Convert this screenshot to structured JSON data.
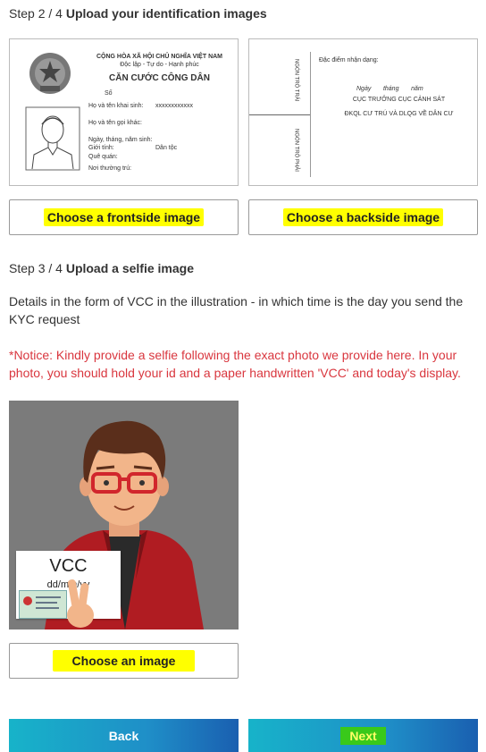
{
  "step2": {
    "prefix": "Step 2 / 4",
    "title": "Upload your identification images"
  },
  "front_card": {
    "line1": "CỘNG HÒA XÃ HỘI CHỦ NGHĨA VIỆT NAM",
    "line2": "Độc lập - Tự do - Hạnh phúc",
    "title": "CĂN CƯỚC CÔNG DÂN",
    "so": "Số",
    "name_label": "Họ và tên khai sinh:",
    "name_value": "xxxxxxxxxxxx",
    "other_name": "Họ và tên gọi khác:",
    "dob": "Ngày, tháng, năm sinh:",
    "gender": "Giới tính:",
    "ethnicity": "Dân tộc",
    "hometown": "Quê quán:",
    "residence": "Nơi thường trú:"
  },
  "back_card": {
    "features": "Đặc điểm nhận dạng:",
    "date_line": "Ngày       tháng       năm",
    "authority1": "CỤC TRƯỞNG CỤC CẢNH SÁT",
    "authority2": "ĐKQL CƯ TRÚ VÀ DLQG VỀ DÂN CƯ",
    "finger1": "NGÓN TRỎ TRÁI",
    "finger2": "NGÓN TRỎ PHẢI"
  },
  "buttons": {
    "front": "Choose a frontside image",
    "back": "Choose a backside image",
    "selfie": "Choose an image",
    "nav_back": "Back",
    "nav_next": "Next"
  },
  "step3": {
    "prefix": "Step 3 / 4",
    "title": "Upload a selfie image"
  },
  "details": "Details in the form of VCC in the illustration - in which time is the day you send the KYC request",
  "notice": "*Notice: Kindly provide a selfie following the exact photo we provide here. In your photo, you should hold your id and a paper handwritten 'VCC' and today's display.",
  "selfie": {
    "sign_main": "VCC",
    "sign_date": "dd/mm/yy"
  },
  "colors": {
    "highlight": "#ffff00",
    "notice": "#d9363e",
    "gradient_start": "#17b3c9",
    "gradient_end": "#1a5fb0"
  }
}
